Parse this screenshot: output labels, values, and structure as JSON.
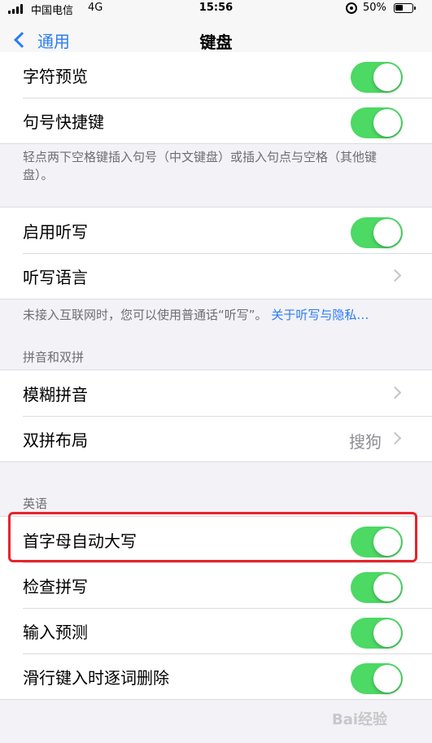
{
  "status": {
    "carrier": "中国电信",
    "network": "4G",
    "time": "15:56",
    "battery": "50%"
  },
  "nav": {
    "back_label": "通用",
    "title": "键盘"
  },
  "groups": {
    "punctuation": {
      "rows": [
        {
          "label": "字符预览",
          "on": true
        },
        {
          "label": "句号快捷键",
          "on": true
        }
      ],
      "footer": "轻点两下空格键插入句号（中文键盘）或插入句点与空格（其他键盘）。"
    },
    "dictation": {
      "rows": [
        {
          "label": "启用听写",
          "on": true
        },
        {
          "label": "听写语言"
        }
      ],
      "footer": "未接入互联网时，您可以使用普通话“听写”。",
      "footer_link": "关于听写与隐私…"
    },
    "pinyin": {
      "header": "拼音和双拼",
      "rows": [
        {
          "label": "模糊拼音"
        },
        {
          "label": "双拼布局",
          "value": "搜狗"
        }
      ]
    },
    "english": {
      "header": "英语",
      "rows": [
        {
          "label": "首字母自动大写",
          "on": true
        },
        {
          "label": "检查拼写",
          "on": true
        },
        {
          "label": "输入预测",
          "on": true
        },
        {
          "label": "滑行键入时逐词删除",
          "on": true
        }
      ]
    }
  },
  "watermark": "Bai经验",
  "colors": {
    "accent": "#2a7bf6",
    "toggle_on": "#4cd964",
    "highlight": "#e8232a"
  }
}
